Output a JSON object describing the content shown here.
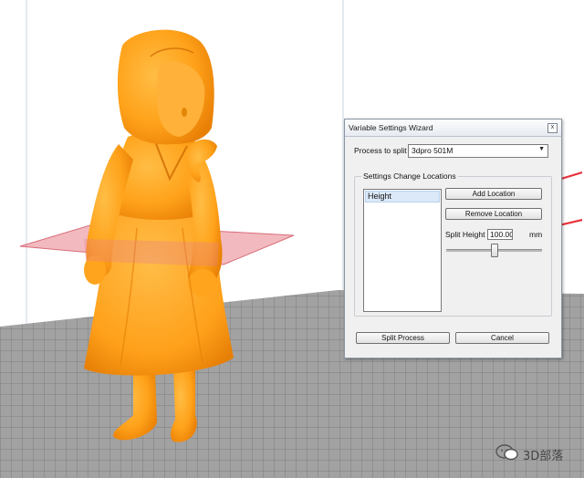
{
  "dialog": {
    "title": "Variable Settings Wizard",
    "close_glyph": "x",
    "process_label": "Process to split",
    "process_value": "3dpro 501M",
    "group_label": "Settings Change Locations",
    "list_items": [
      "Height"
    ],
    "add_location": "Add Location",
    "remove_location": "Remove Location",
    "split_height_label": "Split Height",
    "split_height_value": "100.00",
    "split_height_unit": "mm",
    "split_process": "Split Process",
    "cancel": "Cancel"
  },
  "watermark": {
    "text": "3D部落"
  },
  "colors": {
    "model": "#ffa41c",
    "model_shadow": "#e07d05",
    "split_plane": "#e8828a",
    "arrow": "#e8323c",
    "floor": "#9e9e9e",
    "grid_line": "#7c7c7c"
  }
}
